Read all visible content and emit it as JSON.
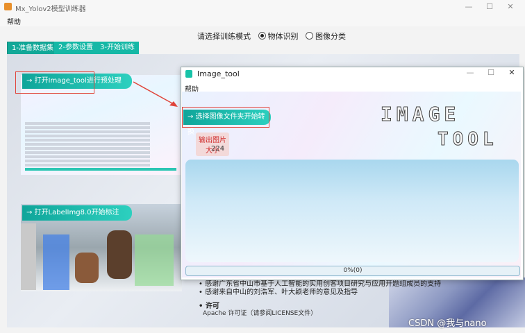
{
  "main_window": {
    "title": "Mx_Yolov2模型训练器",
    "menu": {
      "help": "帮助"
    },
    "mode_prompt": "请选择训练模式",
    "mode_options": [
      {
        "label": "物体识别",
        "selected": true
      },
      {
        "label": "图像分类",
        "selected": false
      }
    ],
    "tabs": [
      {
        "label": "1-准备数据集"
      },
      {
        "label": "2-参数设置"
      },
      {
        "label": "3-开始训练"
      }
    ],
    "steps": {
      "open_image_tool": "打开Image_tool进行预处理",
      "open_labelimg": "打开LabelImg8.0开始标注"
    },
    "acknowledgements": [
      "• 感谢广东省中山市基于人工智能的实用创客项目研究与应用开题组成员的支持",
      "• 感谢来自中山的刘浩军、叶大颖老师的意见及指导"
    ],
    "license_heading": "• 许可",
    "license_text": "Apache 许可证（请参阅LICENSE文件）"
  },
  "dialog": {
    "title": "Image_tool",
    "menu": {
      "help": "帮助"
    },
    "convert_button": "选择图像文件夹开始转换",
    "output_size_label": "输出图片大小",
    "output_size_value": "224",
    "art_line1": "IMAGE",
    "art_line2": "TOOL",
    "progress": {
      "text": "0%(0)",
      "value": 0
    }
  },
  "watermark": "CSDN @我与nano",
  "colors": {
    "teal": "#15b8a6",
    "red_highlight": "#e0443a"
  }
}
